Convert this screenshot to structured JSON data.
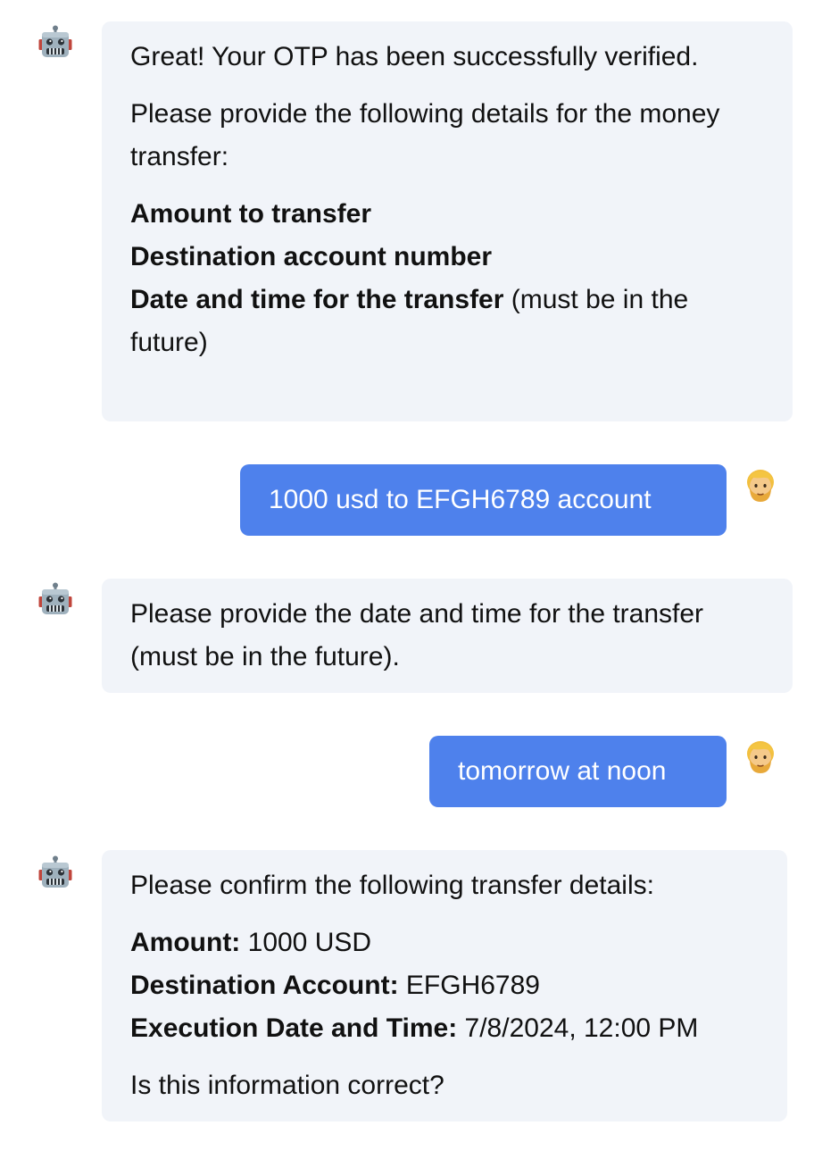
{
  "messages": [
    {
      "role": "bot",
      "avatar_icon": "robot-face-icon",
      "paragraphs": [
        "Great! Your OTP has been successfully verified.",
        "Please provide the following details for the money transfer:"
      ],
      "fields": [
        {
          "label": "Amount to transfer",
          "suffix": ""
        },
        {
          "label": "Destination account number",
          "suffix": ""
        },
        {
          "label": "Date and time for the transfer",
          "suffix": " (must be in the future)"
        }
      ]
    },
    {
      "role": "user",
      "avatar_icon": "person-blond-hair-icon",
      "text": "1000 usd to EFGH6789 account"
    },
    {
      "role": "bot",
      "avatar_icon": "robot-face-icon",
      "text": "Please provide the date and time for the transfer (must be in the future)."
    },
    {
      "role": "user",
      "avatar_icon": "person-blond-hair-icon",
      "text": "tomorrow at noon"
    },
    {
      "role": "bot",
      "avatar_icon": "robot-face-icon",
      "intro": "Please confirm the following transfer details:",
      "details": [
        {
          "label": "Amount:",
          "value": " 1000 USD"
        },
        {
          "label": "Destination Account:",
          "value": " EFGH6789"
        },
        {
          "label": "Execution Date and Time:",
          "value": " 7/8/2024, 12:00 PM"
        }
      ],
      "question": "Is this information correct?"
    }
  ],
  "colors": {
    "bot_bubble": "#f1f4f9",
    "user_bubble": "#4e81ec",
    "user_text": "#ffffff",
    "bot_text": "#111111"
  }
}
